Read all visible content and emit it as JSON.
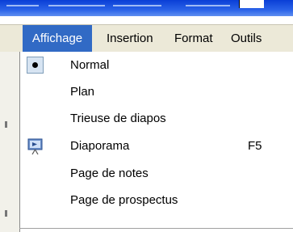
{
  "menubar": {
    "items": [
      {
        "label": "Affichage",
        "active": true
      },
      {
        "label": "Insertion",
        "active": false
      },
      {
        "label": "Format",
        "active": false
      },
      {
        "label": "Outils",
        "active": false
      }
    ]
  },
  "dropdown": {
    "items": [
      {
        "label": "Normal",
        "icon": "radio-selected-icon",
        "shortcut": ""
      },
      {
        "label": "Plan",
        "icon": "",
        "shortcut": ""
      },
      {
        "label": "Trieuse de diapos",
        "icon": "",
        "shortcut": ""
      },
      {
        "label": "Diaporama",
        "icon": "slideshow-icon",
        "shortcut": "F5"
      },
      {
        "label": "Page de notes",
        "icon": "",
        "shortcut": ""
      },
      {
        "label": "Page de prospectus",
        "icon": "",
        "shortcut": ""
      }
    ]
  },
  "colors": {
    "menu_highlight": "#316ac5",
    "menubar_bg": "#ece9d8",
    "title_bar": "#2a62e8"
  }
}
